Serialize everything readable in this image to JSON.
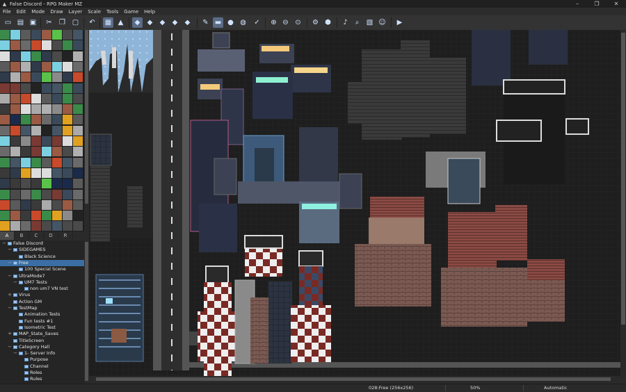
{
  "window": {
    "title": "False Discord - RPG Maker MZ",
    "controls": [
      "minimize",
      "maximize",
      "close"
    ]
  },
  "menu": [
    "File",
    "Edit",
    "Mode",
    "Draw",
    "Layer",
    "Scale",
    "Tools",
    "Game",
    "Help"
  ],
  "toolbar": [
    {
      "name": "new-project",
      "icon": "new-file-icon"
    },
    {
      "name": "open-project",
      "icon": "open-folder-icon"
    },
    {
      "name": "save-project",
      "icon": "save-icon"
    },
    {
      "name": "cut",
      "icon": "scissors-icon"
    },
    {
      "name": "copy",
      "icon": "copy-icon"
    },
    {
      "name": "paste",
      "icon": "paste-icon"
    },
    {
      "name": "undo",
      "icon": "undo-icon"
    },
    {
      "name": "map-mode",
      "icon": "map-icon",
      "active": true
    },
    {
      "name": "event-mode",
      "icon": "event-icon"
    },
    {
      "name": "layer-auto",
      "icon": "layer-icon",
      "active": true
    },
    {
      "name": "layer-1",
      "icon": "layer-icon"
    },
    {
      "name": "layer-2",
      "icon": "layer-icon"
    },
    {
      "name": "layer-3",
      "icon": "layer-icon"
    },
    {
      "name": "layer-4",
      "icon": "layer-icon"
    },
    {
      "name": "pencil",
      "icon": "pencil-icon"
    },
    {
      "name": "rectangle",
      "icon": "rectangle-icon",
      "active": true
    },
    {
      "name": "ellipse",
      "icon": "ellipse-icon"
    },
    {
      "name": "fill",
      "icon": "fill-icon"
    },
    {
      "name": "shadow-pen",
      "icon": "shadow-pen-icon"
    },
    {
      "name": "zoom-in",
      "icon": "zoom-in-icon"
    },
    {
      "name": "zoom-out",
      "icon": "zoom-out-icon"
    },
    {
      "name": "zoom-actual",
      "icon": "zoom-actual-icon"
    },
    {
      "name": "database",
      "icon": "database-icon"
    },
    {
      "name": "plugin-manager",
      "icon": "plugin-icon"
    },
    {
      "name": "sound-test",
      "icon": "speaker-icon"
    },
    {
      "name": "event-searcher",
      "icon": "search-icon"
    },
    {
      "name": "resource-manager",
      "icon": "image-icon"
    },
    {
      "name": "character-generator",
      "icon": "character-icon"
    },
    {
      "name": "playtest",
      "icon": "play-icon"
    }
  ],
  "tileset_tabs": [
    "A",
    "B",
    "C",
    "D",
    "R"
  ],
  "active_tab": "A",
  "map_tree": [
    {
      "label": "False Discord",
      "depth": 0,
      "toggle": "−",
      "icon": "project"
    },
    {
      "label": "SIDEGAMES",
      "depth": 1,
      "toggle": "−"
    },
    {
      "label": "Black Science",
      "depth": 2,
      "toggle": ""
    },
    {
      "label": "Free",
      "depth": 1,
      "toggle": "−",
      "selected": true
    },
    {
      "label": "100 Special Scene",
      "depth": 2,
      "toggle": ""
    },
    {
      "label": "UltraMode7",
      "depth": 1,
      "toggle": "−"
    },
    {
      "label": "UM7 Tests",
      "depth": 2,
      "toggle": "−"
    },
    {
      "label": "non um7 VN test",
      "depth": 3,
      "toggle": ""
    },
    {
      "label": "Virus",
      "depth": 1,
      "toggle": "+"
    },
    {
      "label": "Action GM",
      "depth": 1,
      "toggle": ""
    },
    {
      "label": "TestMap",
      "depth": 1,
      "toggle": "−"
    },
    {
      "label": "Animation Tests",
      "depth": 2,
      "toggle": ""
    },
    {
      "label": "Fun tests #1",
      "depth": 2,
      "toggle": ""
    },
    {
      "label": "Isometric Test",
      "depth": 2,
      "toggle": ""
    },
    {
      "label": "MAP_State_Saves",
      "depth": 1,
      "toggle": "+"
    },
    {
      "label": "TitleScreen",
      "depth": 1,
      "toggle": ""
    },
    {
      "label": "Category Hall",
      "depth": 1,
      "toggle": "−"
    },
    {
      "label": "1- Server Info",
      "depth": 2,
      "toggle": "−"
    },
    {
      "label": "Purpose",
      "depth": 3,
      "toggle": ""
    },
    {
      "label": "Channel",
      "depth": 3,
      "toggle": ""
    },
    {
      "label": "Roles",
      "depth": 3,
      "toggle": ""
    },
    {
      "label": "Rules",
      "depth": 3,
      "toggle": ""
    }
  ],
  "status": {
    "map_info": "028:Free (256x256)",
    "zoom": "50%",
    "mode": "Automatic"
  },
  "colors": {
    "selection": "#3a6ea5",
    "accent": "#5a6b86",
    "background": "#2b2b2b"
  }
}
